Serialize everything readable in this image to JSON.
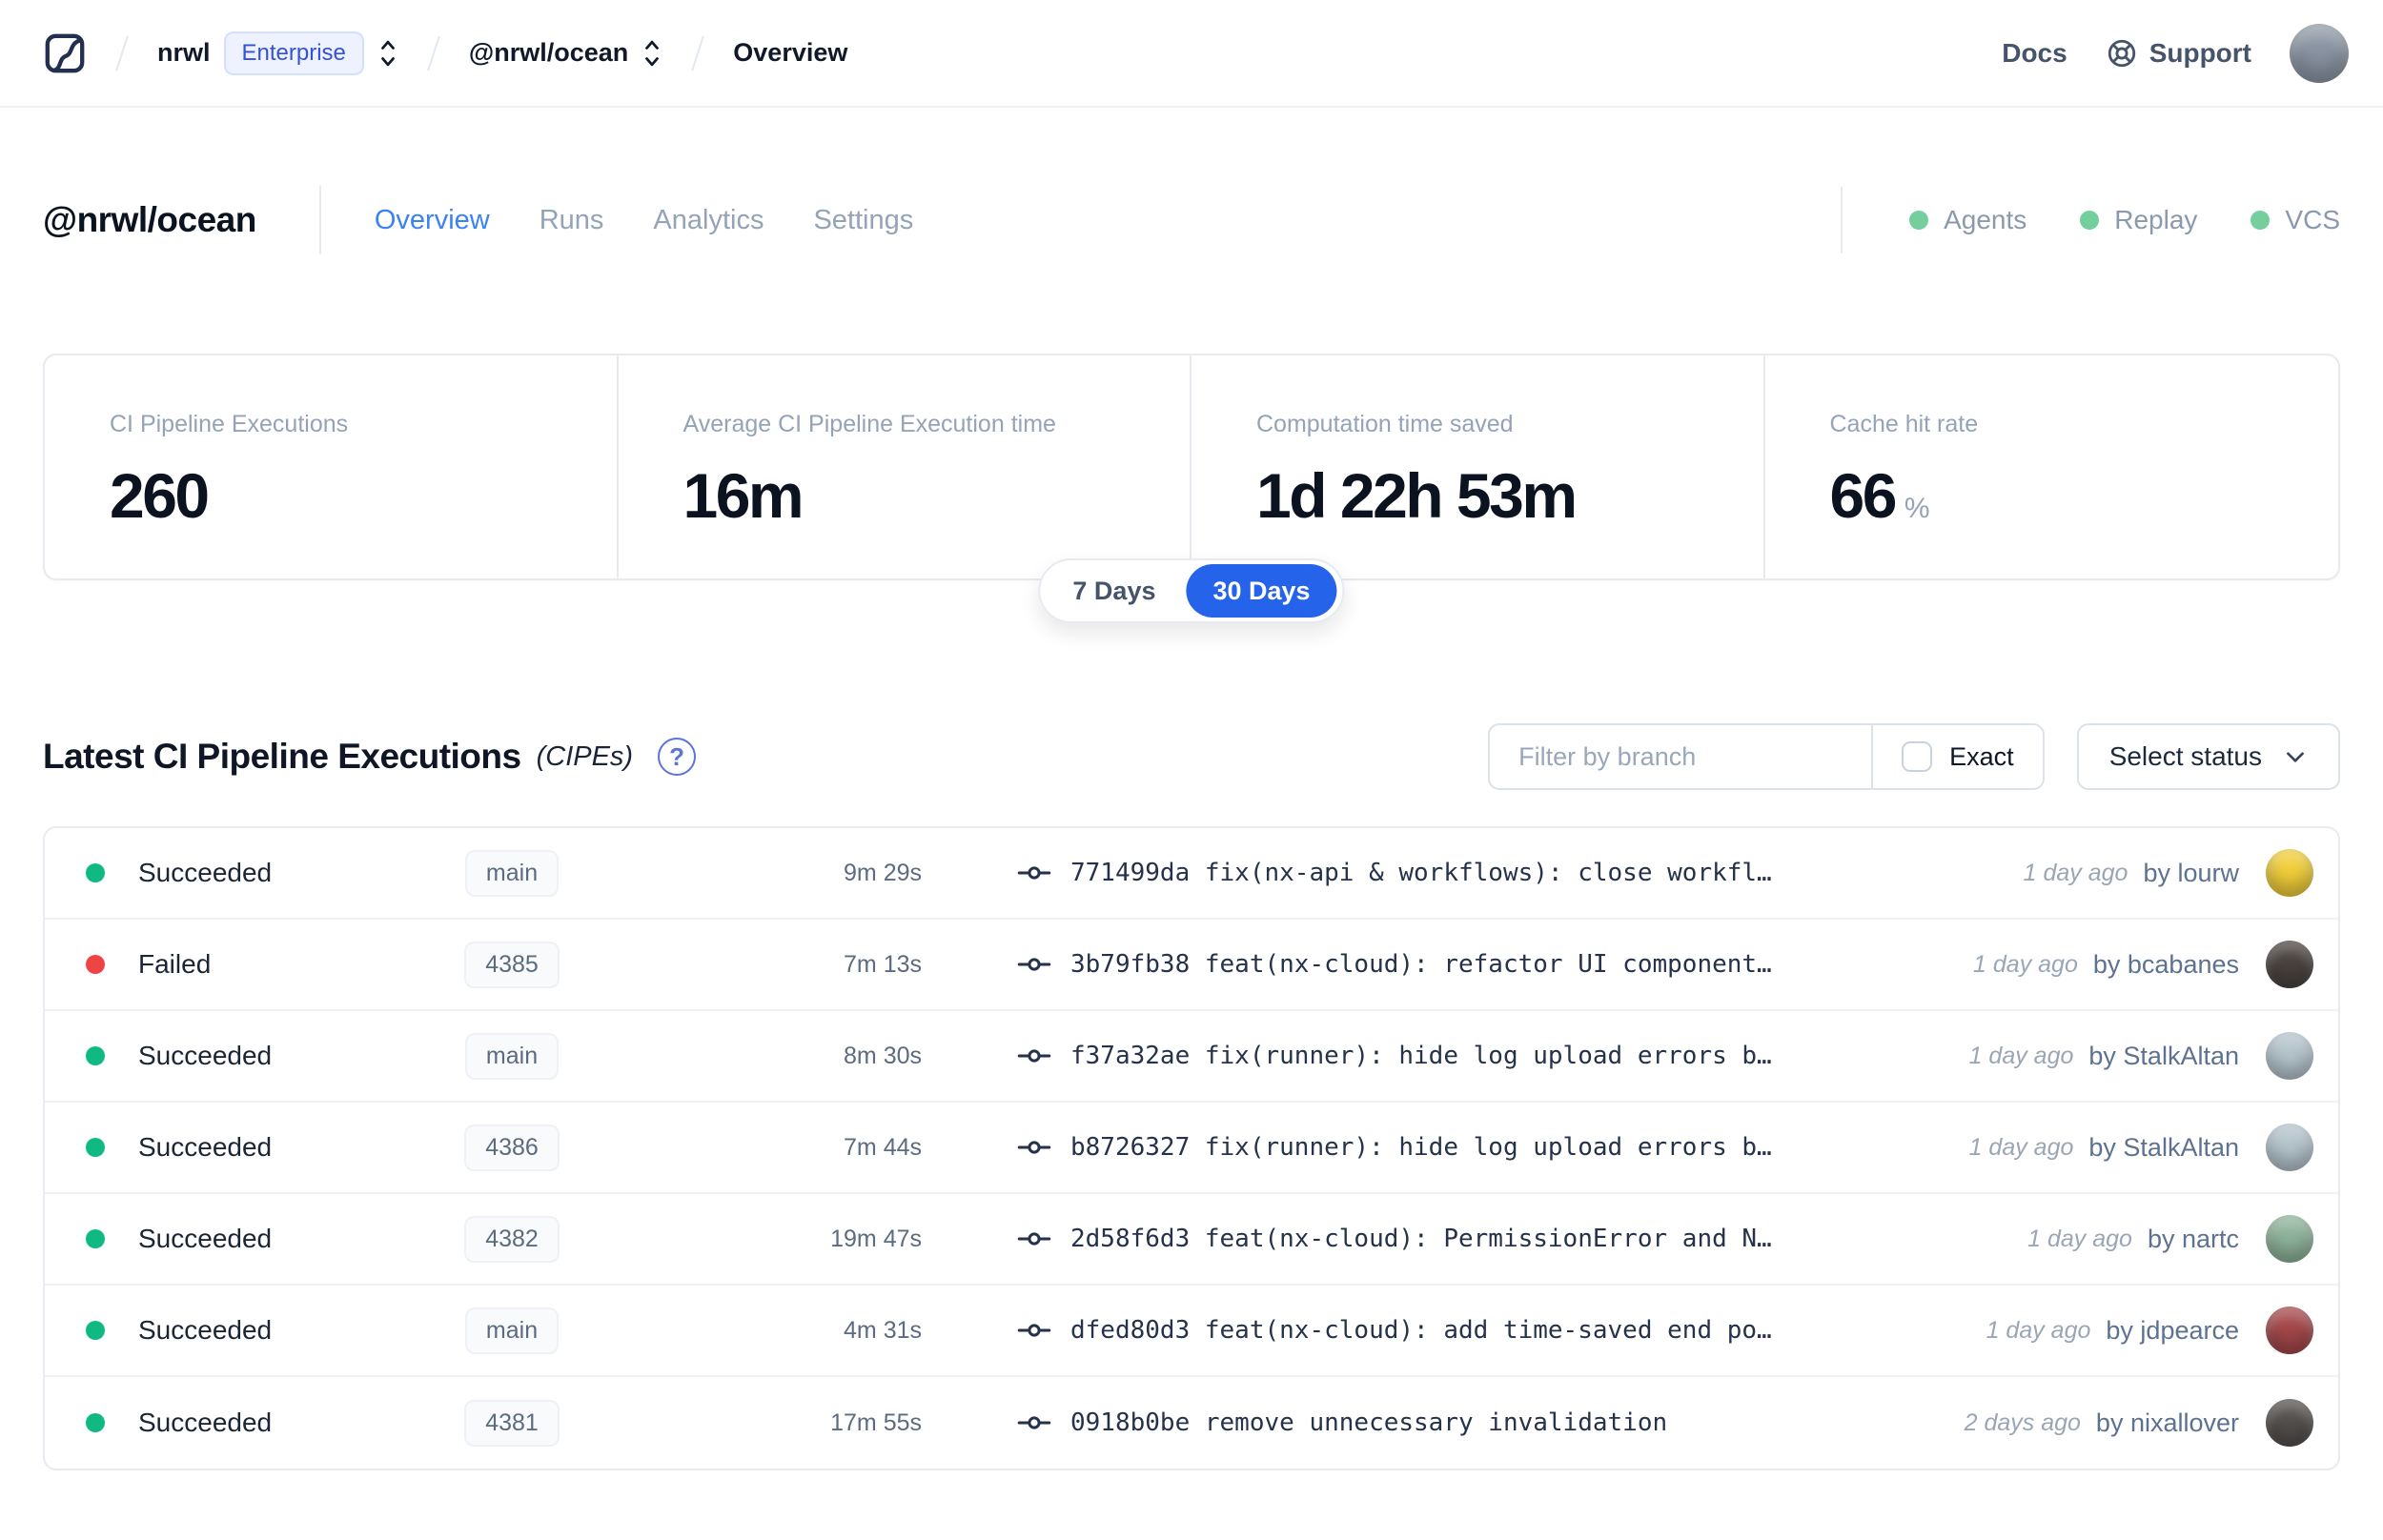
{
  "navbar": {
    "org": "nrwl",
    "org_badge": "Enterprise",
    "workspace": "@nrwl/ocean",
    "page": "Overview",
    "docs_label": "Docs",
    "support_label": "Support",
    "avatar_color": "#8a95a3"
  },
  "header": {
    "title": "@nrwl/ocean",
    "tabs": [
      {
        "label": "Overview",
        "active": true
      },
      {
        "label": "Runs",
        "active": false
      },
      {
        "label": "Analytics",
        "active": false
      },
      {
        "label": "Settings",
        "active": false
      }
    ],
    "service_dot_color": "#74cf9c",
    "services": [
      {
        "label": "Agents"
      },
      {
        "label": "Replay"
      },
      {
        "label": "VCS"
      }
    ]
  },
  "stats": {
    "cards": [
      {
        "label": "CI Pipeline Executions",
        "value": "260",
        "unit": ""
      },
      {
        "label": "Average CI Pipeline Execution time",
        "value": "16m",
        "unit": ""
      },
      {
        "label": "Computation time saved",
        "value": "1d 22h 53m",
        "unit": ""
      },
      {
        "label": "Cache hit rate",
        "value": "66",
        "unit": "%"
      }
    ],
    "range_toggle": {
      "options": [
        "7 Days",
        "30 Days"
      ],
      "selected": "30 Days",
      "selected_color": "#2563eb"
    }
  },
  "icons": {
    "help": "?"
  },
  "cipe_section": {
    "title": "Latest CI Pipeline Executions",
    "subtitle": "(CIPEs)",
    "filter_placeholder": "Filter by branch",
    "exact_label": "Exact",
    "status_dropdown_label": "Select status",
    "rows": [
      {
        "status": "Succeeded",
        "status_color": "#10b981",
        "branch": "main",
        "duration": "9m 29s",
        "commit": "771499da fix(nx-api & workflows): close workfl…",
        "time_ago": "1 day ago",
        "author": "by lourw",
        "avatar_color": "#f2cf3a"
      },
      {
        "status": "Failed",
        "status_color": "#ef4444",
        "branch": "4385",
        "duration": "7m 13s",
        "commit": "3b79fb38 feat(nx-cloud): refactor UI component…",
        "time_ago": "1 day ago",
        "author": "by bcabanes",
        "avatar_color": "#4a4340"
      },
      {
        "status": "Succeeded",
        "status_color": "#10b981",
        "branch": "main",
        "duration": "8m 30s",
        "commit": "f37a32ae fix(runner): hide log upload errors b…",
        "time_ago": "1 day ago",
        "author": "by StalkAltan",
        "avatar_color": "#b6c6ce"
      },
      {
        "status": "Succeeded",
        "status_color": "#10b981",
        "branch": "4386",
        "duration": "7m 44s",
        "commit": "b8726327 fix(runner): hide log upload errors b…",
        "time_ago": "1 day ago",
        "author": "by StalkAltan",
        "avatar_color": "#b6c6ce"
      },
      {
        "status": "Succeeded",
        "status_color": "#10b981",
        "branch": "4382",
        "duration": "19m 47s",
        "commit": "2d58f6d3 feat(nx-cloud): PermissionError and N…",
        "time_ago": "1 day ago",
        "author": "by nartc",
        "avatar_color": "#8fb49b"
      },
      {
        "status": "Succeeded",
        "status_color": "#10b981",
        "branch": "main",
        "duration": "4m 31s",
        "commit": "dfed80d3 feat(nx-cloud): add time-saved end po…",
        "time_ago": "1 day ago",
        "author": "by jdpearce",
        "avatar_color": "#a5484a"
      },
      {
        "status": "Succeeded",
        "status_color": "#10b981",
        "branch": "4381",
        "duration": "17m 55s",
        "commit": "0918b0be remove unnecessary invalidation",
        "time_ago": "2 days ago",
        "author": "by nixallover",
        "avatar_color": "#54504e"
      }
    ]
  }
}
